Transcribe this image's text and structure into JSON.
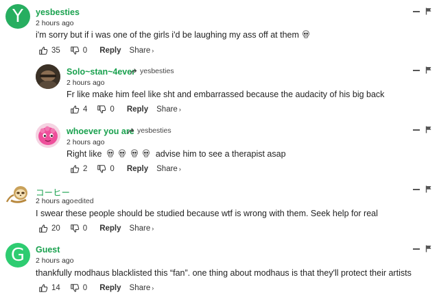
{
  "colors": {
    "author": "#19a14e",
    "avatar_y": "#27ae60",
    "avatar_g": "#2ecc71",
    "muted": "#333333"
  },
  "comments": [
    {
      "author": "yesbesties",
      "avatar_letter": "Y",
      "time": "2 hours ago",
      "text": "i'm sorry but if i was one of the girls i'd be laughing my ass off at them",
      "likes": "35",
      "dislikes": "0",
      "reply_label": "Reply",
      "share_label": "Share"
    },
    {
      "author": "Solo~stan~4ever",
      "reply_to": "yesbesties",
      "time": "2 hours ago",
      "text": "Fr like make him feel like sht and embarrassed because the audacity of his big back",
      "likes": "4",
      "dislikes": "0",
      "reply_label": "Reply",
      "share_label": "Share"
    },
    {
      "author": "whoever you are",
      "reply_to": "yesbesties",
      "time": "2 hours ago",
      "text_prefix": "Right like",
      "text_suffix": "advise him to see a therapist asap",
      "likes": "2",
      "dislikes": "0",
      "reply_label": "Reply",
      "share_label": "Share"
    },
    {
      "author": "コーヒー",
      "time": "2 hours ago",
      "edited": "edited",
      "text": "I swear these people should be studied because wtf is wrong with them. Seek help for real",
      "likes": "20",
      "dislikes": "0",
      "reply_label": "Reply",
      "share_label": "Share"
    },
    {
      "author": "Guest",
      "avatar_letter": "G",
      "time": "2 hours ago",
      "text": "thankfully modhaus blacklisted this “fan”. one thing about modhaus is that they'll protect their artists",
      "likes": "14",
      "dislikes": "0",
      "reply_label": "Reply",
      "share_label": "Share"
    }
  ]
}
